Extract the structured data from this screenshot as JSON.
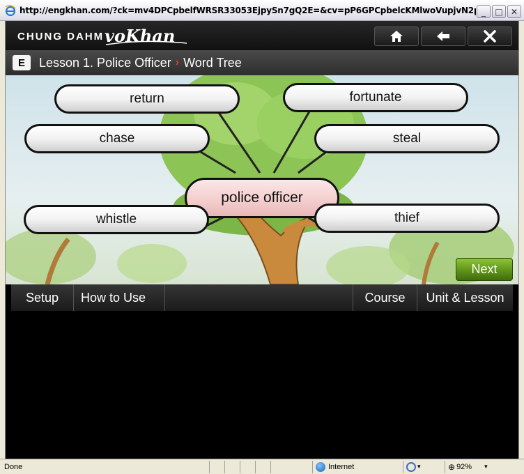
{
  "browser": {
    "title": "http://engkhan.com/?ck=mv4DPCpbelfWRSR33053EjpySn7gQ2E=&cv=pP6GPCpbelcKMlwoVupjvN2pvj...",
    "status_text": "Done",
    "zone_text": "Internet",
    "zoom_text": "92%"
  },
  "header": {
    "brand": "CHUNG DAHM",
    "brand_script": "voKhan"
  },
  "breadcrumb": {
    "badge": "E",
    "lesson": "Lesson 1. Police Officer",
    "separator": "›",
    "page": "Word Tree"
  },
  "word_tree": {
    "center": "police officer",
    "words": [
      "return",
      "fortunate",
      "chase",
      "steal",
      "whistle",
      "thief"
    ]
  },
  "next_label": "Next",
  "bottom_nav": {
    "setup": "Setup",
    "how_to_use": "How to Use",
    "course": "Course",
    "unit_lesson": "Unit & Lesson"
  },
  "colors": {
    "next_green": "#5f9418",
    "breadcrumb_separator": "#e83a2a",
    "center_pill": "#f4cfcf"
  },
  "icons": [
    "ie-icon",
    "home-icon",
    "back-arrow-icon",
    "close-icon",
    "internet-globe-icon",
    "zoom-icon"
  ]
}
